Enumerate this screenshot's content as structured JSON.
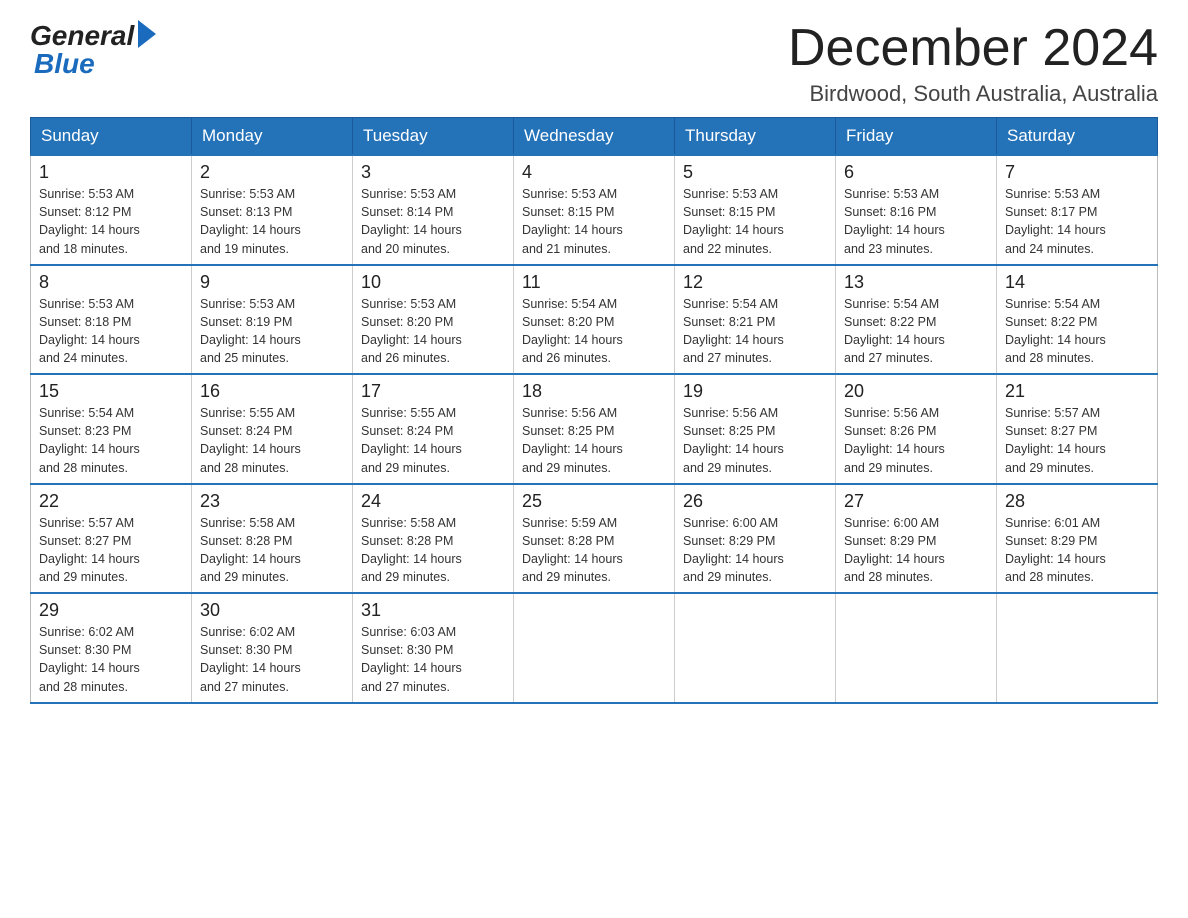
{
  "header": {
    "logo": {
      "general": "General",
      "blue": "Blue"
    },
    "month_title": "December 2024",
    "location": "Birdwood, South Australia, Australia"
  },
  "weekdays": [
    "Sunday",
    "Monday",
    "Tuesday",
    "Wednesday",
    "Thursday",
    "Friday",
    "Saturday"
  ],
  "weeks": [
    [
      {
        "day": "1",
        "sunrise": "5:53 AM",
        "sunset": "8:12 PM",
        "daylight": "14 hours and 18 minutes."
      },
      {
        "day": "2",
        "sunrise": "5:53 AM",
        "sunset": "8:13 PM",
        "daylight": "14 hours and 19 minutes."
      },
      {
        "day": "3",
        "sunrise": "5:53 AM",
        "sunset": "8:14 PM",
        "daylight": "14 hours and 20 minutes."
      },
      {
        "day": "4",
        "sunrise": "5:53 AM",
        "sunset": "8:15 PM",
        "daylight": "14 hours and 21 minutes."
      },
      {
        "day": "5",
        "sunrise": "5:53 AM",
        "sunset": "8:15 PM",
        "daylight": "14 hours and 22 minutes."
      },
      {
        "day": "6",
        "sunrise": "5:53 AM",
        "sunset": "8:16 PM",
        "daylight": "14 hours and 23 minutes."
      },
      {
        "day": "7",
        "sunrise": "5:53 AM",
        "sunset": "8:17 PM",
        "daylight": "14 hours and 24 minutes."
      }
    ],
    [
      {
        "day": "8",
        "sunrise": "5:53 AM",
        "sunset": "8:18 PM",
        "daylight": "14 hours and 24 minutes."
      },
      {
        "day": "9",
        "sunrise": "5:53 AM",
        "sunset": "8:19 PM",
        "daylight": "14 hours and 25 minutes."
      },
      {
        "day": "10",
        "sunrise": "5:53 AM",
        "sunset": "8:20 PM",
        "daylight": "14 hours and 26 minutes."
      },
      {
        "day": "11",
        "sunrise": "5:54 AM",
        "sunset": "8:20 PM",
        "daylight": "14 hours and 26 minutes."
      },
      {
        "day": "12",
        "sunrise": "5:54 AM",
        "sunset": "8:21 PM",
        "daylight": "14 hours and 27 minutes."
      },
      {
        "day": "13",
        "sunrise": "5:54 AM",
        "sunset": "8:22 PM",
        "daylight": "14 hours and 27 minutes."
      },
      {
        "day": "14",
        "sunrise": "5:54 AM",
        "sunset": "8:22 PM",
        "daylight": "14 hours and 28 minutes."
      }
    ],
    [
      {
        "day": "15",
        "sunrise": "5:54 AM",
        "sunset": "8:23 PM",
        "daylight": "14 hours and 28 minutes."
      },
      {
        "day": "16",
        "sunrise": "5:55 AM",
        "sunset": "8:24 PM",
        "daylight": "14 hours and 28 minutes."
      },
      {
        "day": "17",
        "sunrise": "5:55 AM",
        "sunset": "8:24 PM",
        "daylight": "14 hours and 29 minutes."
      },
      {
        "day": "18",
        "sunrise": "5:56 AM",
        "sunset": "8:25 PM",
        "daylight": "14 hours and 29 minutes."
      },
      {
        "day": "19",
        "sunrise": "5:56 AM",
        "sunset": "8:25 PM",
        "daylight": "14 hours and 29 minutes."
      },
      {
        "day": "20",
        "sunrise": "5:56 AM",
        "sunset": "8:26 PM",
        "daylight": "14 hours and 29 minutes."
      },
      {
        "day": "21",
        "sunrise": "5:57 AM",
        "sunset": "8:27 PM",
        "daylight": "14 hours and 29 minutes."
      }
    ],
    [
      {
        "day": "22",
        "sunrise": "5:57 AM",
        "sunset": "8:27 PM",
        "daylight": "14 hours and 29 minutes."
      },
      {
        "day": "23",
        "sunrise": "5:58 AM",
        "sunset": "8:28 PM",
        "daylight": "14 hours and 29 minutes."
      },
      {
        "day": "24",
        "sunrise": "5:58 AM",
        "sunset": "8:28 PM",
        "daylight": "14 hours and 29 minutes."
      },
      {
        "day": "25",
        "sunrise": "5:59 AM",
        "sunset": "8:28 PM",
        "daylight": "14 hours and 29 minutes."
      },
      {
        "day": "26",
        "sunrise": "6:00 AM",
        "sunset": "8:29 PM",
        "daylight": "14 hours and 29 minutes."
      },
      {
        "day": "27",
        "sunrise": "6:00 AM",
        "sunset": "8:29 PM",
        "daylight": "14 hours and 28 minutes."
      },
      {
        "day": "28",
        "sunrise": "6:01 AM",
        "sunset": "8:29 PM",
        "daylight": "14 hours and 28 minutes."
      }
    ],
    [
      {
        "day": "29",
        "sunrise": "6:02 AM",
        "sunset": "8:30 PM",
        "daylight": "14 hours and 28 minutes."
      },
      {
        "day": "30",
        "sunrise": "6:02 AM",
        "sunset": "8:30 PM",
        "daylight": "14 hours and 27 minutes."
      },
      {
        "day": "31",
        "sunrise": "6:03 AM",
        "sunset": "8:30 PM",
        "daylight": "14 hours and 27 minutes."
      },
      null,
      null,
      null,
      null
    ]
  ],
  "labels": {
    "sunrise": "Sunrise:",
    "sunset": "Sunset:",
    "daylight": "Daylight:"
  }
}
